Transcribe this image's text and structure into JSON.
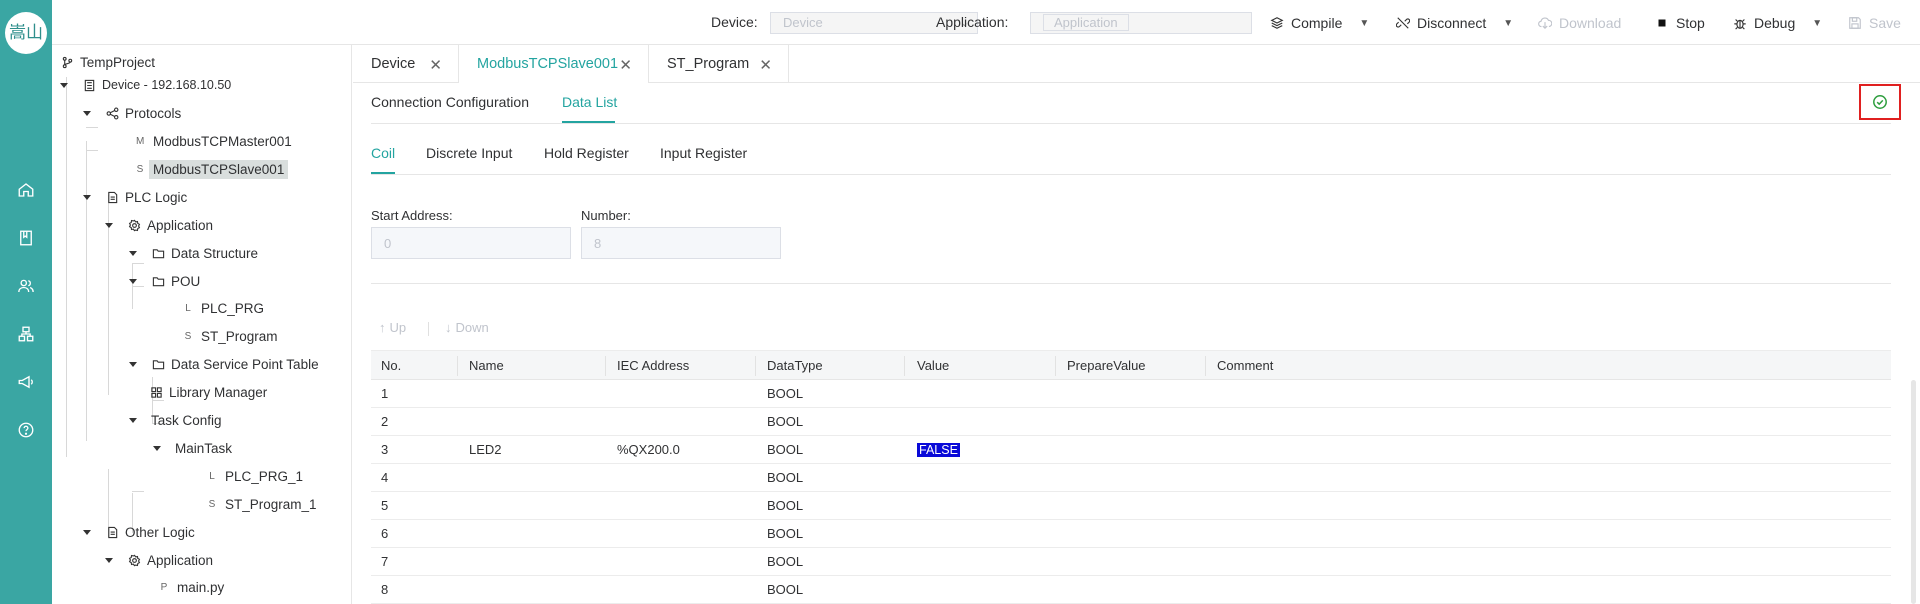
{
  "logo": {
    "text": "嵩山"
  },
  "rail_icons": [
    "home-icon",
    "book-icon",
    "users-icon",
    "sitemap-icon",
    "megaphone-icon",
    "help-icon"
  ],
  "topbar": {
    "device_label": "Device:",
    "device_placeholder": "Device",
    "application_label": "Application:",
    "application_placeholder": "Application",
    "compile": "Compile",
    "disconnect": "Disconnect",
    "download": "Download",
    "stop": "Stop",
    "debug": "Debug",
    "save": "Save"
  },
  "tree": {
    "project": "TempProject",
    "device": "Device - 192.168.10.50",
    "protocols": "Protocols",
    "master": "ModbusTCPMaster001",
    "master_letter": "M",
    "slave": "ModbusTCPSlave001",
    "slave_letter": "S",
    "plc_logic": "PLC Logic",
    "application": "Application",
    "data_structure": "Data Structure",
    "pou": "POU",
    "plc_prg": "PLC_PRG",
    "plc_prg_letter": "L",
    "st_program": "ST_Program",
    "st_program_letter": "S",
    "data_service": "Data Service Point Table",
    "library_manager": "Library Manager",
    "task_config": "Task Config",
    "main_task": "MainTask",
    "plc_prg_1": "PLC_PRG_1",
    "plc_prg_1_letter": "L",
    "st_program_1": "ST_Program_1",
    "st_program_1_letter": "S",
    "other_logic": "Other Logic",
    "application2": "Application",
    "main_py": "main.py",
    "main_py_letter": "P"
  },
  "tabs": [
    {
      "label": "Device"
    },
    {
      "label": "ModbusTCPSlave001"
    },
    {
      "label": "ST_Program"
    }
  ],
  "sections": {
    "connection_config": "Connection Configuration",
    "data_list": "Data List"
  },
  "register_tabs": [
    "Coil",
    "Discrete Input",
    "Hold Register",
    "Input Register"
  ],
  "form": {
    "start_address_label": "Start Address:",
    "start_address_value": "0",
    "number_label": "Number:",
    "number_value": "8"
  },
  "actions": {
    "up": "Up",
    "down": "Down"
  },
  "table": {
    "headers": [
      "No.",
      "Name",
      "IEC Address",
      "DataType",
      "Value",
      "PrepareValue",
      "Comment"
    ],
    "rows": [
      {
        "no": "1",
        "name": "",
        "iec": "",
        "type": "BOOL",
        "value": "",
        "prepare": "",
        "comment": ""
      },
      {
        "no": "2",
        "name": "",
        "iec": "",
        "type": "BOOL",
        "value": "",
        "prepare": "",
        "comment": ""
      },
      {
        "no": "3",
        "name": "LED2",
        "iec": "%QX200.0",
        "type": "BOOL",
        "value": "FALSE",
        "prepare": "",
        "comment": ""
      },
      {
        "no": "4",
        "name": "",
        "iec": "",
        "type": "BOOL",
        "value": "",
        "prepare": "",
        "comment": ""
      },
      {
        "no": "5",
        "name": "",
        "iec": "",
        "type": "BOOL",
        "value": "",
        "prepare": "",
        "comment": ""
      },
      {
        "no": "6",
        "name": "",
        "iec": "",
        "type": "BOOL",
        "value": "",
        "prepare": "",
        "comment": ""
      },
      {
        "no": "7",
        "name": "",
        "iec": "",
        "type": "BOOL",
        "value": "",
        "prepare": "",
        "comment": ""
      },
      {
        "no": "8",
        "name": "",
        "iec": "",
        "type": "BOOL",
        "value": "",
        "prepare": "",
        "comment": ""
      }
    ]
  },
  "colors": {
    "accent": "#23a4a0",
    "rail": "#3aa6a3",
    "highlight": "#0a0ad8",
    "alert": "#e02020",
    "ok": "#2e9e3e"
  }
}
